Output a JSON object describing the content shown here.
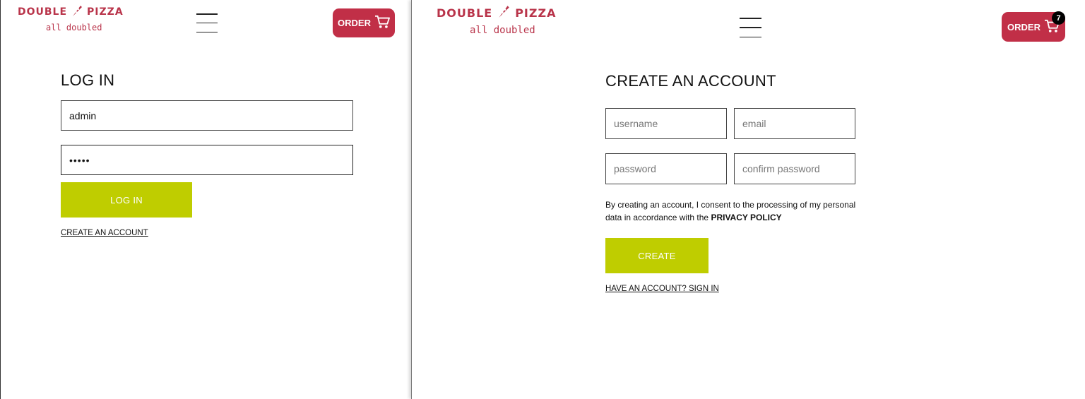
{
  "brand": {
    "name_left": "DOUBLE",
    "name_right": "PIZZA",
    "tagline": "all doubled",
    "color": "#b9344a"
  },
  "icons": {
    "logo": "pizza-slice-icon",
    "menu": "hamburger-menu-icon",
    "cart": "shopping-cart-icon"
  },
  "colors": {
    "order_button": "#c12f47",
    "primary_button": "#bfcd00"
  },
  "login_panel": {
    "order_label": "ORDER",
    "title": "LOG IN",
    "username_value": "admin",
    "password_value": "•••••",
    "submit_label": "LOG IN",
    "create_account_link": "CREATE AN ACCOUNT"
  },
  "register_panel": {
    "order_label": "ORDER",
    "cart_count": "7",
    "title": "CREATE AN ACCOUNT",
    "username_placeholder": "username",
    "email_placeholder": "email",
    "password_placeholder": "password",
    "confirm_password_placeholder": "confirm password",
    "consent_text": "By creating an account, I consent to the processing of my personal data in accordance with the",
    "privacy_policy_link": "PRIVACY POLICY",
    "submit_label": "CREATE",
    "sign_in_link": "HAVE AN ACCOUNT? SIGN IN"
  }
}
